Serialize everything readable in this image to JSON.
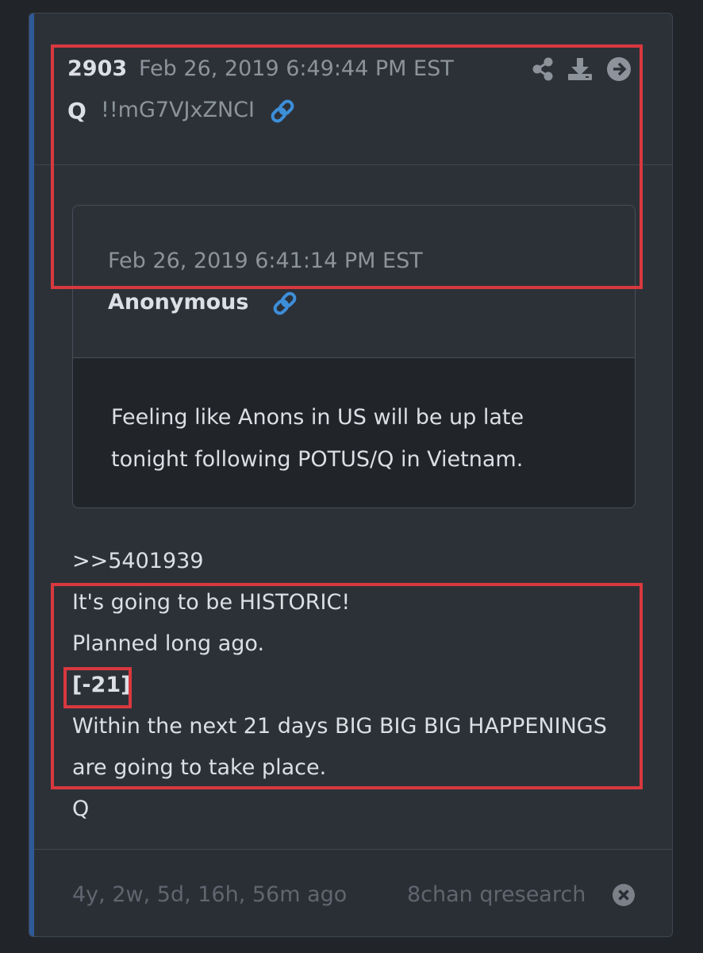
{
  "post": {
    "number": "2903",
    "timestamp": "Feb 26, 2019 6:49:44 PM EST",
    "author": "Q",
    "tripcode": "!!mG7VJxZNCI",
    "icons": [
      "share-icon",
      "download-icon",
      "arrow-right-circle-icon",
      "link-icon"
    ]
  },
  "quoted_post": {
    "timestamp": "Feb 26, 2019 6:41:14 PM EST",
    "author": "Anonymous",
    "text_line1": "Feeling like Anons in US will be up late",
    "text_line2": "tonight following POTUS/Q in Vietnam."
  },
  "message": {
    "reply_ref": ">>5401939",
    "line1": "It's going to be HISTORIC!",
    "line2": "Planned long ago.",
    "line3": "[-21]",
    "line4": "Within the next 21 days BIG BIG BIG HAPPENINGS",
    "line5": "are going to take place.",
    "signature": "Q"
  },
  "footer": {
    "age": "4y, 2w, 5d, 16h, 56m ago",
    "source": "8chan qresearch",
    "close_icon": "close-circle-icon"
  },
  "colors": {
    "background": "#212529",
    "card": "#2c3138",
    "accent_bar": "#2f5a9a",
    "link": "#3d8fd9",
    "highlight_box": "#d9383f"
  }
}
